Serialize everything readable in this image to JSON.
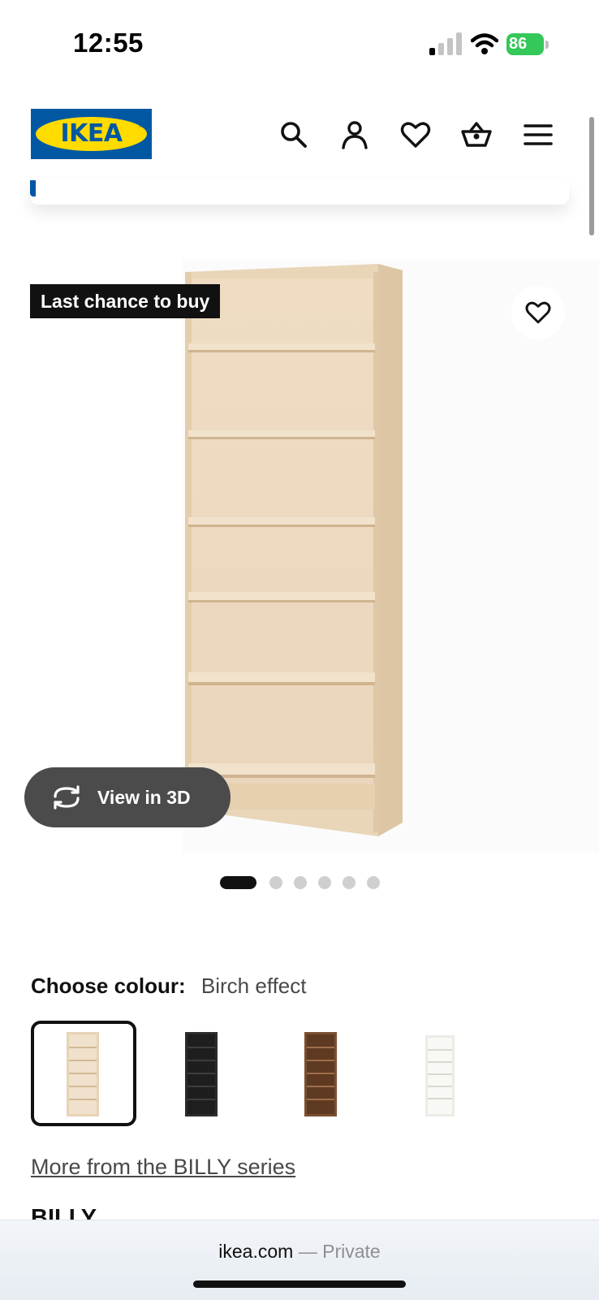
{
  "status_bar": {
    "time": "12:55",
    "battery": "86",
    "icons": [
      "cellular-signal-icon",
      "wifi-icon",
      "battery-charging-icon"
    ]
  },
  "header": {
    "logo_text": "IKEA",
    "logo_registered": "®",
    "icons": [
      "search-icon",
      "account-icon",
      "favourites-icon",
      "basket-icon",
      "menu-icon"
    ]
  },
  "gallery": {
    "badge": "Last chance to buy",
    "view_3d_label": "View in 3D",
    "image_count": 6,
    "active_image_index": 0
  },
  "colour_picker": {
    "label": "Choose colour:",
    "selected_value": "Birch effect",
    "swatches": [
      {
        "colour": "#e7d3b5",
        "selected": true
      },
      {
        "colour": "#2b2b2b",
        "selected": false
      },
      {
        "colour": "#7a4f30",
        "selected": false
      },
      {
        "colour": "#f2f2ee",
        "selected": false
      }
    ]
  },
  "series_link": "More from the BILLY series",
  "product_name": "BILLY",
  "browser": {
    "domain": "ikea.com",
    "mode": " — Private"
  },
  "colors": {
    "ikea_blue": "#0058a3",
    "ikea_yellow": "#ffdb00",
    "battery_green": "#34c759",
    "birch": "#e7d3b5"
  }
}
